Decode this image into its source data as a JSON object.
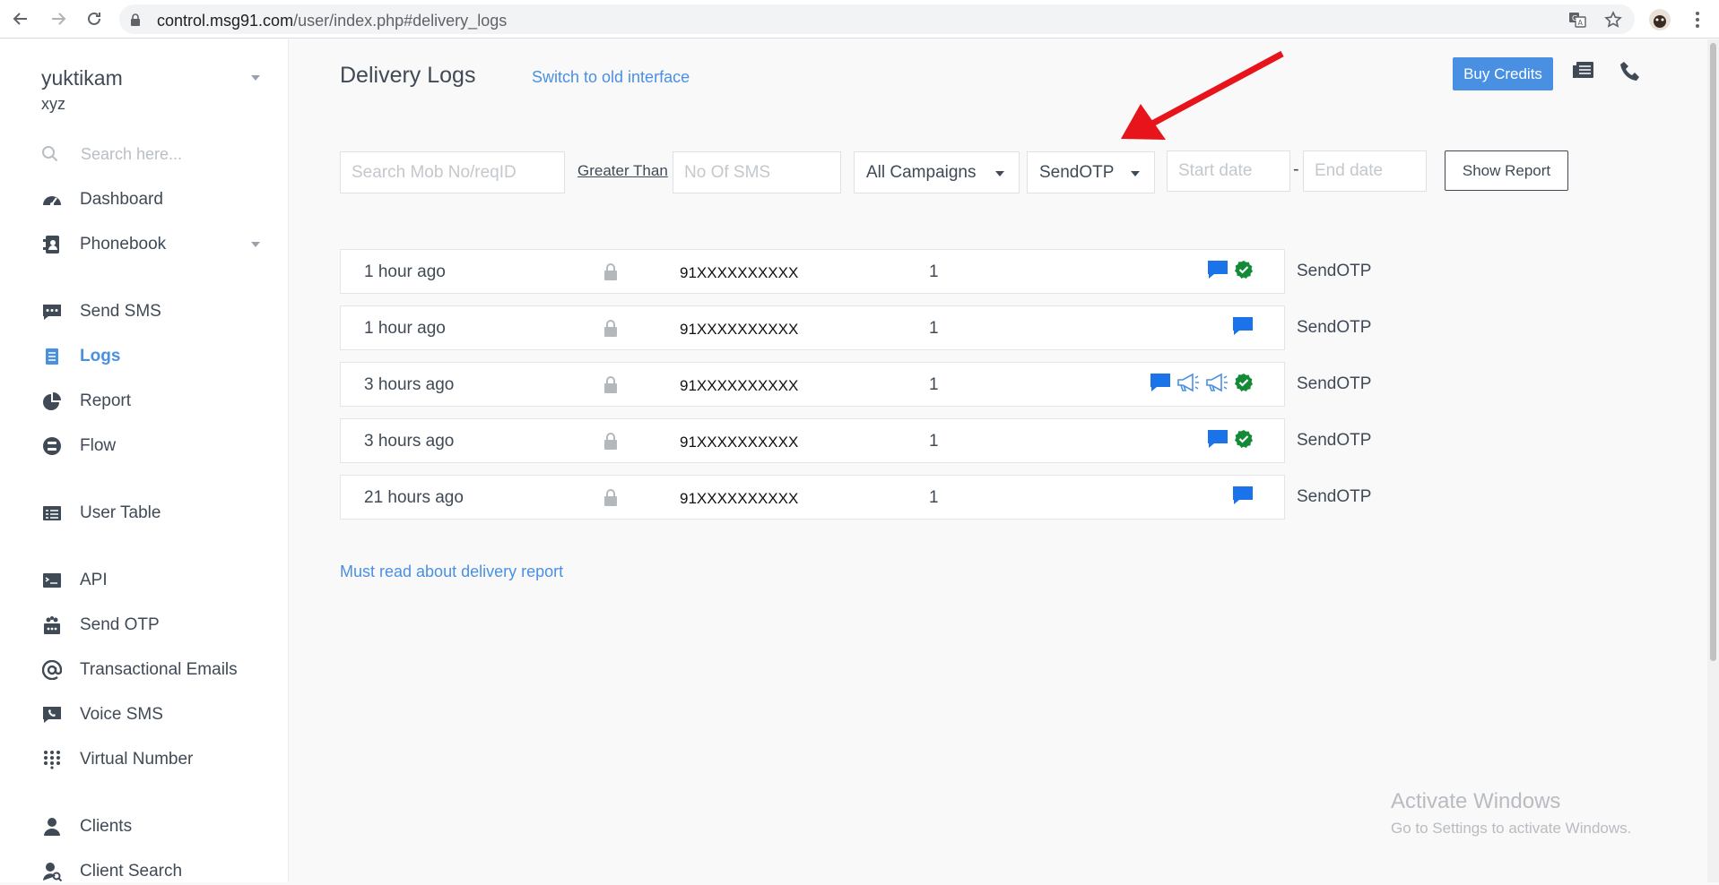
{
  "browser": {
    "url_host": "control.msg91.com",
    "url_path": "/user/index.php#delivery_logs",
    "icons": [
      "back-icon",
      "forward-icon",
      "reload-icon",
      "lock-icon",
      "translate-icon",
      "star-icon",
      "profile-avatar",
      "menu-dots-icon"
    ]
  },
  "sidebar": {
    "account_name": "yuktikam",
    "account_org": "xyz",
    "search_placeholder": "Search here...",
    "items": [
      {
        "label": "Dashboard",
        "icon": "dashboard-icon"
      },
      {
        "label": "Phonebook",
        "icon": "phonebook-icon",
        "has_caret": true
      },
      {
        "label": "Send SMS",
        "icon": "sms-icon"
      },
      {
        "label": "Logs",
        "icon": "logs-icon",
        "active": true
      },
      {
        "label": "Report",
        "icon": "pie-chart-icon"
      },
      {
        "label": "Flow",
        "icon": "flow-icon"
      },
      {
        "label": "User Table",
        "icon": "table-icon"
      },
      {
        "label": "API",
        "icon": "api-icon"
      },
      {
        "label": "Send OTP",
        "icon": "otp-icon"
      },
      {
        "label": "Transactional Emails",
        "icon": "at-icon"
      },
      {
        "label": "Voice SMS",
        "icon": "voice-icon"
      },
      {
        "label": "Virtual Number",
        "icon": "dialpad-icon"
      },
      {
        "label": "Clients",
        "icon": "clients-icon"
      },
      {
        "label": "Client Search",
        "icon": "client-search-icon"
      }
    ]
  },
  "header": {
    "title": "Delivery Logs",
    "switch_link": "Switch to old interface",
    "buy_credits": "Buy Credits"
  },
  "filters": {
    "search_placeholder": "Search Mob No/reqID",
    "greater_than": "Greater Than",
    "sms_count_placeholder": "No Of SMS",
    "campaign": "All Campaigns",
    "route": "SendOTP",
    "start_placeholder": "Start date",
    "end_placeholder": "End date",
    "dash": "-",
    "show_report": "Show Report"
  },
  "logs": [
    {
      "time": "1 hour ago",
      "mobile": "91XXXXXXXXXX",
      "count": "1",
      "status_icons": [
        "message-icon",
        "delivered-check-icon"
      ],
      "campaign": "SendOTP"
    },
    {
      "time": "1 hour ago",
      "mobile": "91XXXXXXXXXX",
      "count": "1",
      "status_icons": [
        "message-icon"
      ],
      "campaign": "SendOTP"
    },
    {
      "time": "3 hours ago",
      "mobile": "91XXXXXXXXXX",
      "count": "1",
      "status_icons": [
        "message-icon",
        "megaphone-icon",
        "megaphone-icon",
        "delivered-check-icon"
      ],
      "campaign": "SendOTP"
    },
    {
      "time": "3 hours ago",
      "mobile": "91XXXXXXXXXX",
      "count": "1",
      "status_icons": [
        "message-icon",
        "delivered-check-icon"
      ],
      "campaign": "SendOTP"
    },
    {
      "time": "21 hours ago",
      "mobile": "91XXXXXXXXXX",
      "count": "1",
      "status_icons": [
        "message-icon"
      ],
      "campaign": "SendOTP"
    }
  ],
  "footer_link": "Must read about delivery report",
  "watermark": {
    "title": "Activate Windows",
    "subtitle": "Go to Settings to activate Windows."
  },
  "colors": {
    "accent": "#4a90e2",
    "message": "#1a73e8",
    "delivered": "#138a36",
    "annotation_arrow": "#e8141b"
  }
}
